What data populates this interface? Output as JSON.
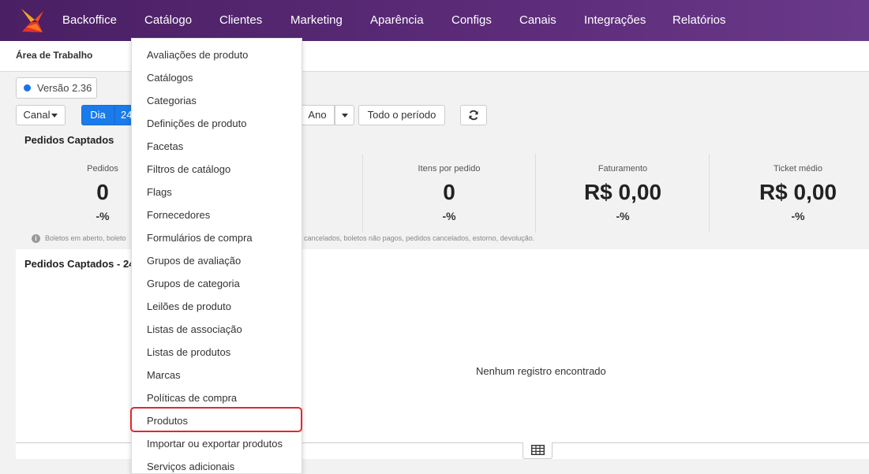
{
  "nav": {
    "items": [
      "Backoffice",
      "Catálogo",
      "Clientes",
      "Marketing",
      "Aparência",
      "Configs",
      "Canais",
      "Integrações",
      "Relatórios"
    ]
  },
  "breadcrumb": "Área de Trabalho",
  "version": "Versão 2.36",
  "filters": {
    "canal": "Canal",
    "dia": "Dia",
    "dia_value": "24",
    "ano": "Ano",
    "todo_periodo": "Todo o período"
  },
  "pedidos_section_title": "Pedidos Captados",
  "stats": [
    {
      "label": "Pedidos",
      "value": "0",
      "change": "-%"
    },
    {
      "label": "Itens por pedido",
      "value": "0",
      "change": "-%"
    },
    {
      "label": "Faturamento",
      "value": "R$ 0,00",
      "change": "-%"
    },
    {
      "label": "Ticket médio",
      "value": "R$ 0,00",
      "change": "-%"
    }
  ],
  "note_left": "Boletos em aberto, boleto",
  "note_right": "es cancelados, boletos não pagos, pedidos cancelados, estorno, devolução.",
  "chart_title": "Pedidos Captados - 24",
  "empty_message": "Nenhum registro encontrado",
  "dropdown": {
    "items": [
      "Avaliações de produto",
      "Catálogos",
      "Categorias",
      "Definições de produto",
      "Facetas",
      "Filtros de catálogo",
      "Flags",
      "Fornecedores",
      "Formulários de compra",
      "Grupos de avaliação",
      "Grupos de categoria",
      "Leilões de produto",
      "Listas de associação",
      "Listas de produtos",
      "Marcas",
      "Políticas de compra",
      "Produtos",
      "Importar ou exportar produtos",
      "Serviços adicionais"
    ],
    "highlighted": "Produtos"
  },
  "colors": {
    "nav_bg": "#5b2b78",
    "primary": "#1a7bea",
    "highlight": "#e0282e"
  }
}
